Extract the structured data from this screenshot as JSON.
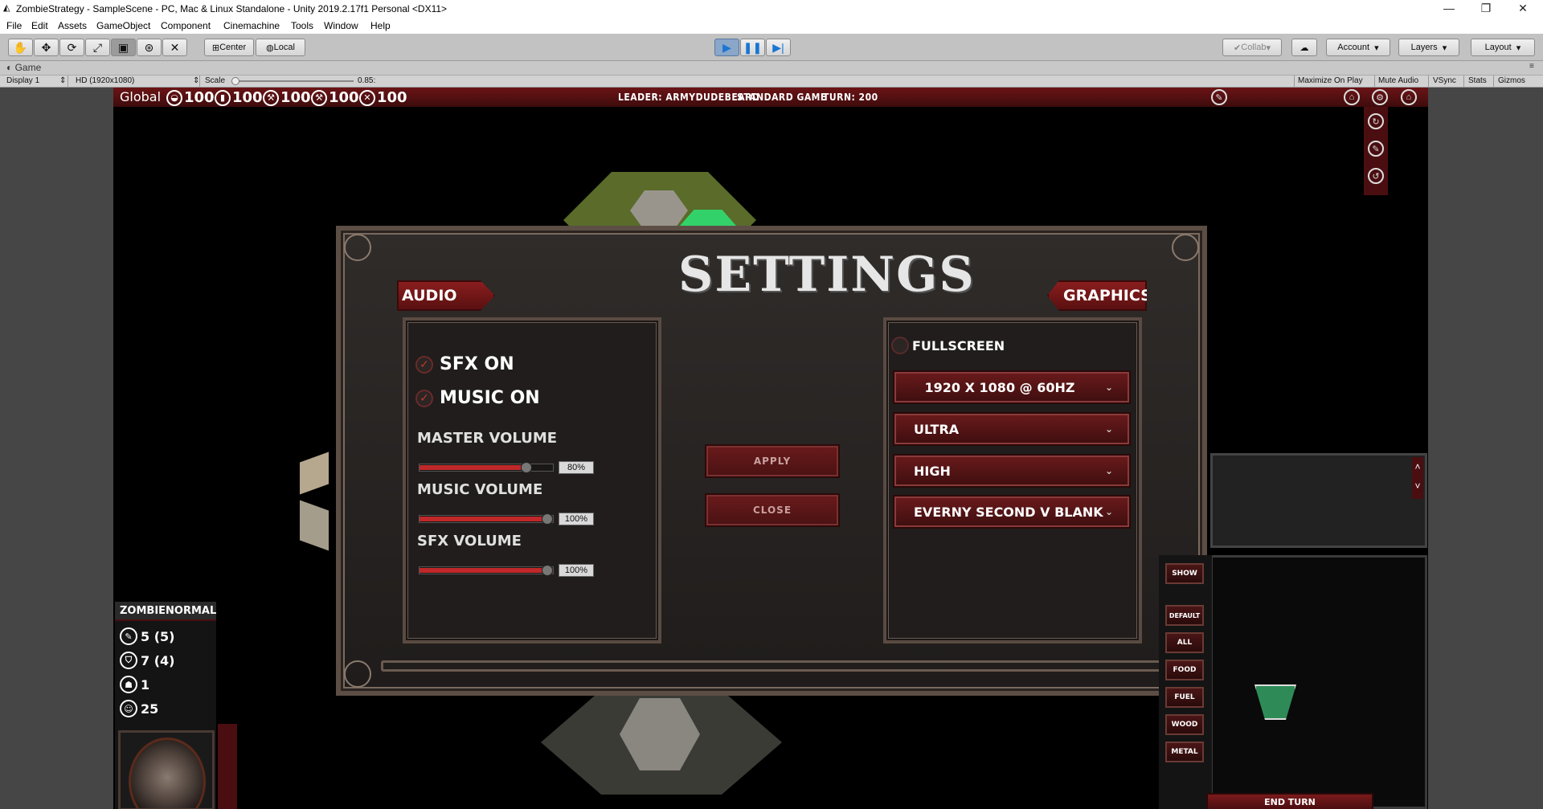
{
  "window": {
    "title": "ZombieStrategy - SampleScene - PC, Mac & Linux Standalone - Unity 2019.2.17f1 Personal <DX11>",
    "minimize": "—",
    "maximize": "❐",
    "close": "✕"
  },
  "menu": [
    "File",
    "Edit",
    "Assets",
    "GameObject",
    "Component",
    "Cinemachine",
    "Tools",
    "Window",
    "Help"
  ],
  "toolbar": {
    "pivot": "Center",
    "space": "Local",
    "collab": "Collab",
    "account": "Account",
    "layers": "Layers",
    "layout": "Layout"
  },
  "game_view": {
    "tab": "Game",
    "display": "Display 1",
    "resolution": "HD (1920x1080)",
    "scale_label": "Scale",
    "scale_value": "0.85:",
    "options": [
      "Maximize On Play",
      "Mute Audio",
      "VSync",
      "Stats",
      "Gizmos"
    ]
  },
  "hud": {
    "global_label": "Global",
    "resources": [
      "100",
      "100",
      "100",
      "100",
      "100"
    ],
    "leader": "LEADER: ARMYDUDEBEARD",
    "mode": "STANDARD GAME",
    "turn": "TURN: 200"
  },
  "settings": {
    "title": "SETTINGS",
    "audio_tab": "AUDIO",
    "graphics_tab": "GRAPHICS",
    "sfx_on": "SFX ON",
    "music_on": "MUSIC ON",
    "master_volume": {
      "label": "MASTER VOLUME",
      "value": 0.8,
      "text": "80%"
    },
    "music_volume": {
      "label": "MUSIC VOLUME",
      "value": 1.0,
      "text": "100%"
    },
    "sfx_volume": {
      "label": "SFX VOLUME",
      "value": 1.0,
      "text": "100%"
    },
    "apply": "APPLY",
    "close": "CLOSE",
    "fullscreen": "FULLSCREEN",
    "resolution": "1920 X 1080 @ 60HZ",
    "quality": "ULTRA",
    "texture": "HIGH",
    "vsync": "EVERNY SECOND V BLANK"
  },
  "unit": {
    "name": "ZOMBIENORMAL",
    "attack": "5 (5)",
    "defense": "7 (4)",
    "moves": "1",
    "health": "25"
  },
  "side_buttons": [
    "SHOW",
    "DEFAULT",
    "ALL",
    "FOOD",
    "FUEL",
    "WOOD",
    "METAL"
  ],
  "end_turn": "END TURN",
  "scroll_up": "˄",
  "scroll_down": "˅"
}
